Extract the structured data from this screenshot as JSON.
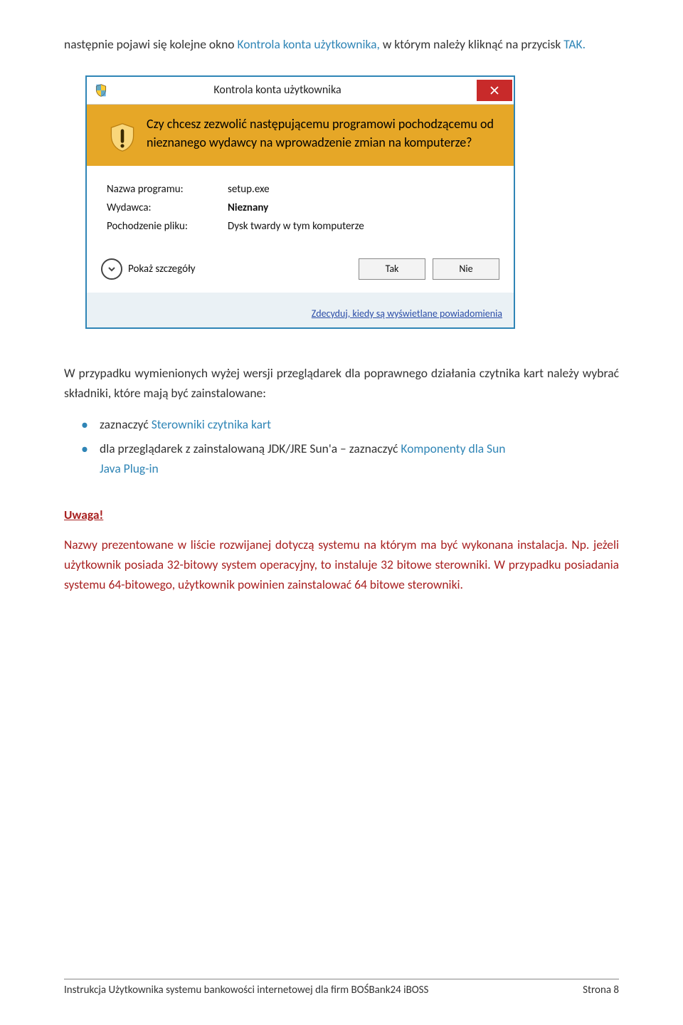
{
  "intro": {
    "pre": "następnie pojawi się kolejne okno ",
    "hl1": "Kontrola konta użytkownika,",
    "mid": " w którym należy kliknąć na przycisk ",
    "hl2": "TAK."
  },
  "dialog": {
    "title": "Kontrola konta użytkownika",
    "banner": "Czy chcesz zezwolić następującemu programowi pochodzącemu od nieznanego wydawcy na wprowadzenie zmian na komputerze?",
    "rows": {
      "prog_label": "Nazwa programu:",
      "prog_val": "setup.exe",
      "pub_label": "Wydawca:",
      "pub_val": "Nieznany",
      "orig_label": "Pochodzenie pliku:",
      "orig_val": "Dysk twardy w tym komputerze"
    },
    "expand": "Pokaż szczegóły",
    "yes": "Tak",
    "no": "Nie",
    "footer_link": "Zdecyduj, kiedy są wyświetlane powiadomienia"
  },
  "mid": {
    "text": "W przypadku wymienionych wyżej wersji przeglądarek dla poprawnego działania czytnika kart należy wybrać składniki, które mają być zainstalowane:"
  },
  "bullets": {
    "b1_pre": "zaznaczyć ",
    "b1_blue": "Sterowniki czytnika kart",
    "b2_pre": "dla przeglądarek z zainstalowaną JDK/JRE Sun'a – zaznaczyć ",
    "b2_blue1": "Komponenty dla Sun",
    "b2_blue2": "Java Plug-in"
  },
  "warning": {
    "title": "Uwaga!",
    "body": "Nazwy prezentowane w liście rozwijanej dotyczą systemu na którym ma być wykonana instalacja. Np. jeżeli użytkownik posiada 32-bitowy system operacyjny, to instaluje 32 bitowe sterowniki. W przypadku posiadania systemu 64-bitowego, użytkownik powinien zainstalować 64 bitowe sterowniki."
  },
  "footer": {
    "left": "Instrukcja Użytkownika systemu bankowości internetowej dla firm BOŚBank24 iBOSS",
    "right": "Strona 8"
  }
}
